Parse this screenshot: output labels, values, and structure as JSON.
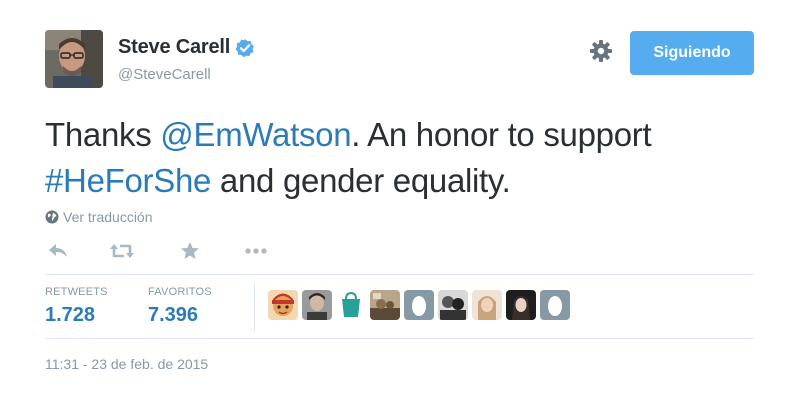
{
  "user": {
    "display_name": "Steve Carell",
    "handle": "@SteveCarell",
    "verified": true
  },
  "header": {
    "follow_button_label": "Siguiendo",
    "settings_icon": "gear-icon"
  },
  "tweet": {
    "text_part1": "Thanks ",
    "mention": "@EmWatson",
    "text_part2": ". An honor to support ",
    "hashtag": "#HeForShe",
    "text_part3": " and gender equality."
  },
  "translate": {
    "label": "Ver traducción",
    "icon": "globe-icon"
  },
  "actions": [
    {
      "name": "reply",
      "icon": "reply-icon"
    },
    {
      "name": "retweet",
      "icon": "retweet-icon"
    },
    {
      "name": "favorite",
      "icon": "star-icon"
    },
    {
      "name": "more",
      "icon": "more-icon"
    }
  ],
  "stats": {
    "retweets_label": "RETWEETS",
    "retweets_value": "1.728",
    "favorites_label": "FAVORITOS",
    "favorites_value": "7.396"
  },
  "favoriters": [
    {
      "kind": "cartoon",
      "color": "#c0504d"
    },
    {
      "kind": "photo",
      "color": "#6b6b6b"
    },
    {
      "kind": "logo",
      "color": "#2aa198"
    },
    {
      "kind": "photo",
      "color": "#8a6d4b"
    },
    {
      "kind": "default-egg",
      "color": "#8899a6"
    },
    {
      "kind": "photo",
      "color": "#444444"
    },
    {
      "kind": "photo",
      "color": "#c9a27e"
    },
    {
      "kind": "photo",
      "color": "#2f2f2f"
    },
    {
      "kind": "default-egg",
      "color": "#8899a6"
    }
  ],
  "timestamp": "11:31 - 23 de feb. de 2015",
  "colors": {
    "accent": "#55acee",
    "link": "#2b7bb9",
    "muted": "#8899a6",
    "text": "#292f33"
  }
}
